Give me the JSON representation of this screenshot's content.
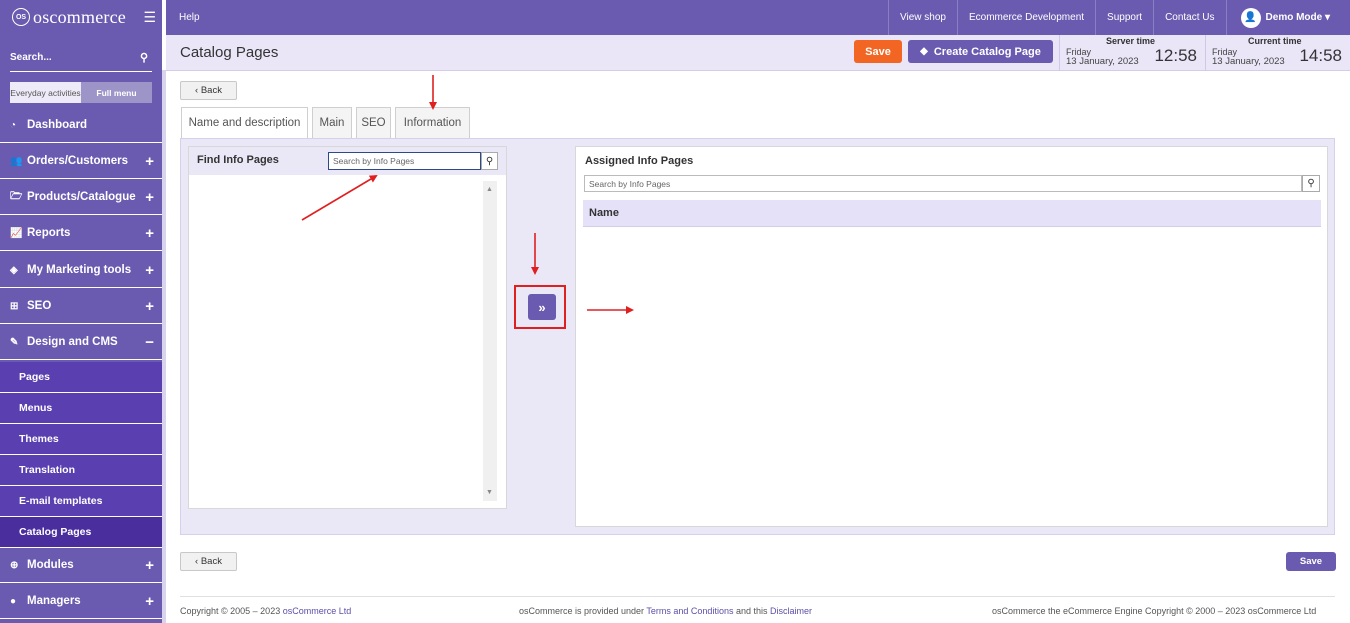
{
  "brand": {
    "name": "oscommerce",
    "mark": "OS"
  },
  "sidebar": {
    "search_label": "Search...",
    "toggle": {
      "everyday": "Everyday activities",
      "full": "Full menu"
    },
    "items": [
      {
        "label": "Dashboard",
        "icon": "dashboard-icon",
        "glyph": "◔",
        "expand": ""
      },
      {
        "label": "Orders/Customers",
        "icon": "users-icon",
        "glyph": "👥",
        "expand": "+"
      },
      {
        "label": "Products/Catalogue",
        "icon": "folder-icon",
        "glyph": "🗁",
        "expand": "+"
      },
      {
        "label": "Reports",
        "icon": "chart-icon",
        "glyph": "📈",
        "expand": "+"
      },
      {
        "label": "My Marketing tools",
        "icon": "tag-icon",
        "glyph": "◈",
        "expand": "+"
      },
      {
        "label": "SEO",
        "icon": "sitemap-icon",
        "glyph": "⊞",
        "expand": "+"
      },
      {
        "label": "Design and CMS",
        "icon": "brush-icon",
        "glyph": "✎",
        "expand": "−"
      }
    ],
    "subitems": [
      "Pages",
      "Menus",
      "Themes",
      "Translation",
      "E-mail templates",
      "Catalog Pages"
    ],
    "items_after": [
      {
        "label": "Modules",
        "icon": "puzzle-icon",
        "glyph": "⊕",
        "expand": "+"
      },
      {
        "label": "Managers",
        "icon": "user-icon",
        "glyph": "●",
        "expand": "+"
      }
    ]
  },
  "topbar": {
    "help": "Help",
    "links": [
      "View shop",
      "Ecommerce Development",
      "Support",
      "Contact Us"
    ],
    "user": "Demo Mode ▾"
  },
  "header": {
    "title": "Catalog Pages",
    "save": "Save",
    "create": "Create Catalog Page",
    "server_time": {
      "label": "Server time",
      "day": "Friday",
      "date": "13 January, 2023",
      "time": "12:58"
    },
    "current_time": {
      "label": "Current time",
      "day": "Friday",
      "date": "13 January, 2023",
      "time": "14:58"
    }
  },
  "content": {
    "back": "‹ Back",
    "tabs": [
      "Name and description",
      "Main",
      "SEO",
      "Information"
    ],
    "find": {
      "title": "Find Info Pages",
      "placeholder": "Search by Info Pages"
    },
    "assigned": {
      "title": "Assigned Info Pages",
      "placeholder": "Search by Info Pages",
      "column": "Name"
    },
    "assign_button": "»",
    "save": "Save"
  },
  "footer": {
    "left_prefix": "Copyright © 2005 – 2023 ",
    "left_link": "osCommerce Ltd",
    "mid_prefix": "osCommerce is provided under ",
    "mid_link1": "Terms and Conditions",
    "mid_and": " and this ",
    "mid_link2": "Disclaimer",
    "right": "osCommerce the eCommerce Engine Copyright © 2000 – 2023 osCommerce Ltd"
  },
  "colors": {
    "brand": "#6a5bb0",
    "accent": "#f26522",
    "annotation": "#e02020"
  }
}
